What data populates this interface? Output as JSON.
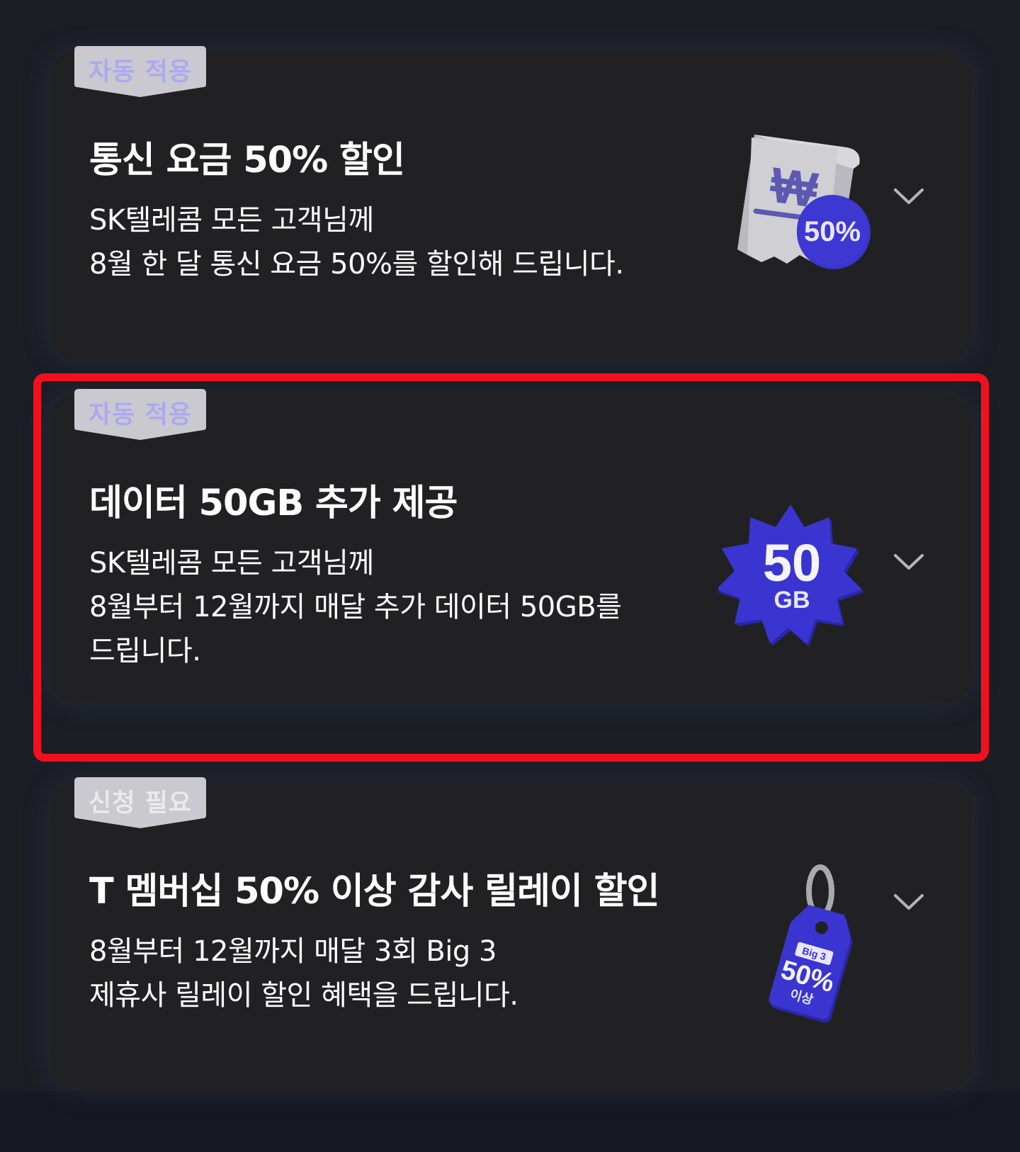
{
  "benefits": [
    {
      "badge": "자동 적용",
      "title": "통신 요금 50% 할인",
      "desc": [
        "SK텔레콤 모든 고객님께",
        "8월 한 달 통신 요금 50%를 할인해 드립니다."
      ],
      "illustration": {
        "icon": "receipt-icon",
        "currency": "₩",
        "label": "50%"
      }
    },
    {
      "badge": "자동 적용",
      "title": "데이터 50GB 추가 제공",
      "desc": [
        "SK텔레콤 모든 고객님께",
        "8월부터 12월까지 매달 추가 데이터 50GB를",
        "드립니다."
      ],
      "illustration": {
        "icon": "data-badge-icon",
        "value": "50",
        "unit": "GB"
      }
    },
    {
      "badge": "신청 필요",
      "title": "T 멤버십 50% 이상 감사 릴레이 할인",
      "desc": [
        "8월부터 12월까지 매달 3회 Big 3",
        "제휴사 릴레이 할인 혜택을 드립니다."
      ],
      "illustration": {
        "icon": "price-tag-icon",
        "tag_top": "Big 3",
        "tag_value": "50%",
        "tag_bottom": "이상"
      }
    }
  ],
  "colors": {
    "background": "#1b1e25",
    "card": "#212123",
    "accent_blue": "#3a35c9",
    "badge_auto_text": "#aea8f0",
    "highlight": "#f2101f"
  }
}
